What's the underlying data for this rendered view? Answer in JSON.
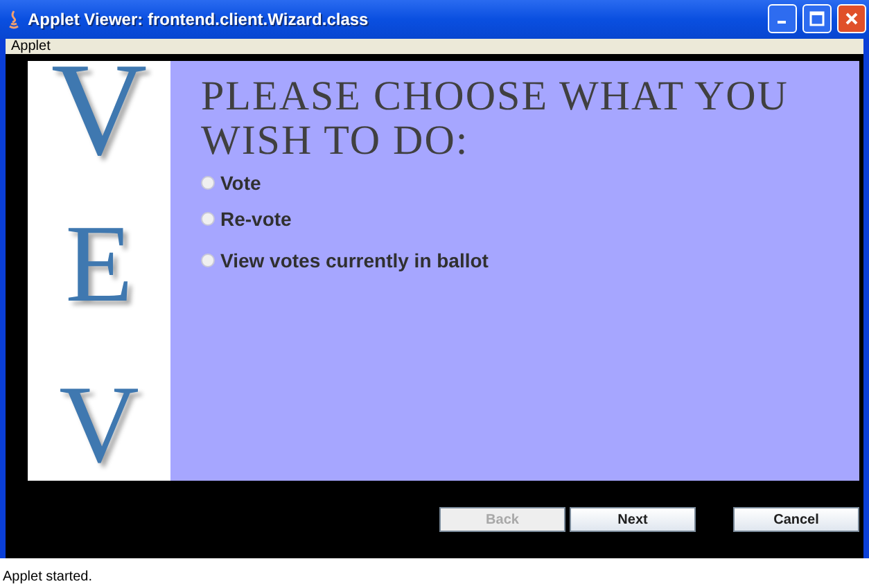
{
  "window": {
    "title": "Applet Viewer: frontend.client.Wizard.class"
  },
  "menu": [
    "Applet"
  ],
  "logo_letters": [
    "V",
    "E",
    "V"
  ],
  "heading": "PLEASE CHOOSE WHAT YOU WISH TO DO:",
  "options": [
    {
      "label": "Vote",
      "selected": false
    },
    {
      "label": "Re-vote",
      "selected": false
    },
    {
      "label": "View votes currently in ballot",
      "selected": false
    }
  ],
  "buttons": [
    {
      "label": "Back",
      "disabled": true
    },
    {
      "label": "Next",
      "disabled": false
    },
    {
      "label": "Cancel",
      "disabled": false
    }
  ],
  "status_bar": "Applet started."
}
